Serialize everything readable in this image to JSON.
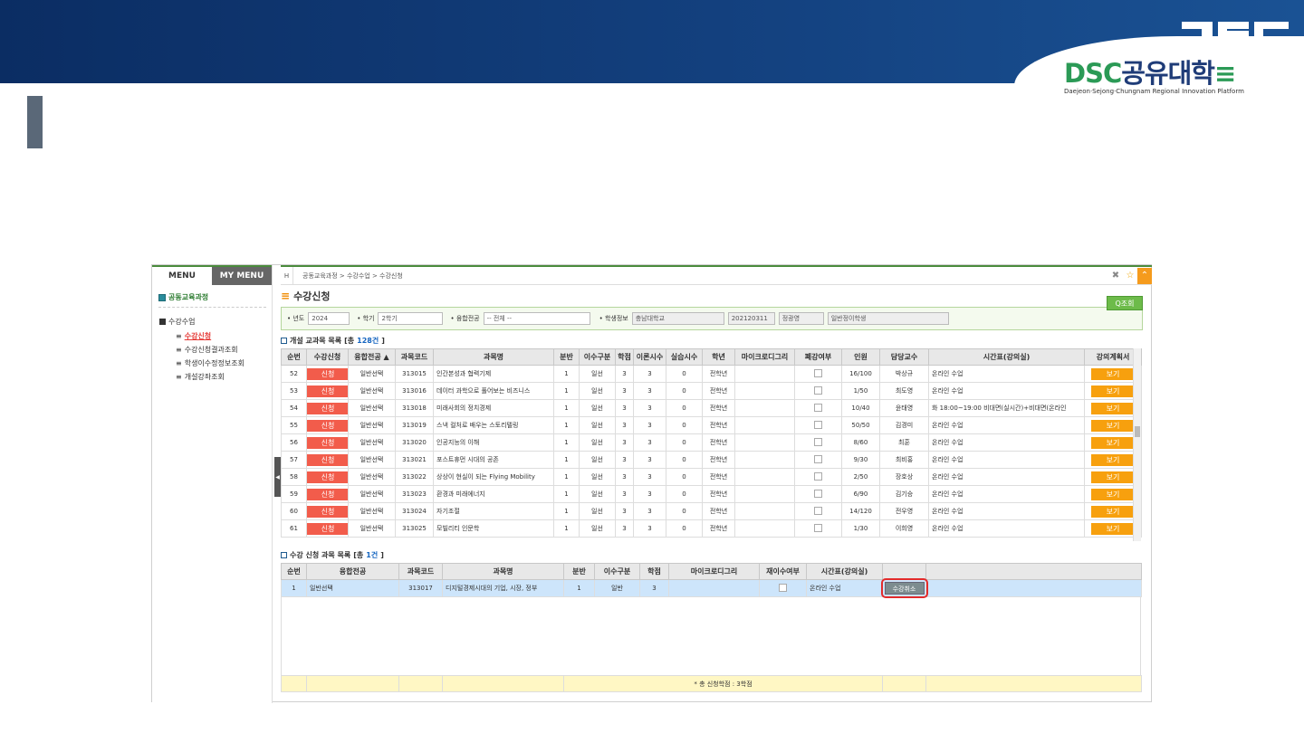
{
  "logo": {
    "mark": "DSC",
    "brand_dsc": "DSC",
    "brand_kor": "공유대학",
    "tagline": "Daejeon·Sejong·Chungnam Regional Innovation Platform"
  },
  "sidebar": {
    "tabs": [
      "MENU",
      "MY MENU"
    ],
    "header": "공동교육과정",
    "root": "수강수업",
    "items": [
      "수강신청",
      "수강신청결과조회",
      "학생이수정정보조회",
      "개설강좌조회"
    ]
  },
  "crumb": {
    "home": "H",
    "path": "공동교육과정 > 수강수업 > 수강신청"
  },
  "page": {
    "title": "수강신청",
    "search_button": "Q조회"
  },
  "filter": {
    "year_label": "• 년도",
    "year": "2024",
    "term_label": "• 학기",
    "term": "2학기",
    "major_label": "• 융합전공",
    "major": "-- 전체 --",
    "student_label": "• 학생정보",
    "school": "충남대학교",
    "student_id": "202120311",
    "student_name": "정광영",
    "student_type": "일반정이학생"
  },
  "course_list": {
    "title": "개설 교과목 목록",
    "count_prefix": "[총 ",
    "count": "128건",
    "count_suffix": "]",
    "headers": [
      "순번",
      "수강신청",
      "융합전공 ▲",
      "과목코드",
      "과목명",
      "분반",
      "이수구분",
      "학점",
      "이론시수",
      "실습시수",
      "학년",
      "마이크로디그리",
      "폐강여부",
      "인원",
      "담당교수",
      "시간표(강의실)",
      "강의계획서"
    ],
    "rows": [
      [
        "52",
        "신청",
        "일반선택",
        "313015",
        "인간본성과 협력기제",
        "1",
        "일선",
        "3",
        "3",
        "0",
        "전학년",
        "",
        "",
        "16/100",
        "박상규",
        "온라인 수업",
        "보기"
      ],
      [
        "53",
        "신청",
        "일반선택",
        "313016",
        "데이터 과학으로 풀어보는 비즈니스",
        "1",
        "일선",
        "3",
        "3",
        "0",
        "전학년",
        "",
        "",
        "1/50",
        "최도영",
        "온라인 수업",
        "보기"
      ],
      [
        "54",
        "신청",
        "일반선택",
        "313018",
        "미래사회의 정치경제",
        "1",
        "일선",
        "3",
        "3",
        "0",
        "전학년",
        "",
        "",
        "10/40",
        "윤태영",
        "화 18:00~19:00 비대면(실시간)+비대면(온라인",
        "보기"
      ],
      [
        "55",
        "신청",
        "일반선택",
        "313019",
        "스낵 컬처로 배우는 스토리텔링",
        "1",
        "일선",
        "3",
        "3",
        "0",
        "전학년",
        "",
        "",
        "50/50",
        "김경미",
        "온라인 수업",
        "보기"
      ],
      [
        "56",
        "신청",
        "일반선택",
        "313020",
        "인공지능의 이해",
        "1",
        "일선",
        "3",
        "3",
        "0",
        "전학년",
        "",
        "",
        "8/60",
        "최훈",
        "온라인 수업",
        "보기"
      ],
      [
        "57",
        "신청",
        "일반선택",
        "313021",
        "포스트휴먼 시대의 공존",
        "1",
        "일선",
        "3",
        "3",
        "0",
        "전학년",
        "",
        "",
        "9/30",
        "최비홍",
        "온라인 수업",
        "보기"
      ],
      [
        "58",
        "신청",
        "일반선택",
        "313022",
        "상상이 현실이 되는 Flying Mobility",
        "1",
        "일선",
        "3",
        "3",
        "0",
        "전학년",
        "",
        "",
        "2/50",
        "장호상",
        "온라인 수업",
        "보기"
      ],
      [
        "59",
        "신청",
        "일반선택",
        "313023",
        "환경과 미래에너지",
        "1",
        "일선",
        "3",
        "3",
        "0",
        "전학년",
        "",
        "",
        "6/90",
        "김기승",
        "온라인 수업",
        "보기"
      ],
      [
        "60",
        "신청",
        "일반선택",
        "313024",
        "자기조절",
        "1",
        "일선",
        "3",
        "3",
        "0",
        "전학년",
        "",
        "",
        "14/120",
        "전우영",
        "온라인 수업",
        "보기"
      ],
      [
        "61",
        "신청",
        "일반선택",
        "313025",
        "모빌리티 인문학",
        "1",
        "일선",
        "3",
        "3",
        "0",
        "전학년",
        "",
        "",
        "1/30",
        "이희영",
        "온라인 수업",
        "보기"
      ]
    ]
  },
  "applied_list": {
    "title": "수강 신청 과목 목록",
    "count_prefix": "[총 ",
    "count": "1건",
    "count_suffix": "]",
    "headers": [
      "순번",
      "융합전공",
      "과목코드",
      "과목명",
      "분반",
      "이수구분",
      "학점",
      "마이크로디그리",
      "재이수여부",
      "시간표(강의실)",
      ""
    ],
    "rows": [
      [
        "1",
        "일반선택",
        "313017",
        "디지털경제시대의 기업, 시장, 정부",
        "1",
        "일반",
        "3",
        "",
        "",
        "온라인 수업",
        "수강취소"
      ]
    ],
    "total": "* 총 신청학점 : 3학점"
  }
}
